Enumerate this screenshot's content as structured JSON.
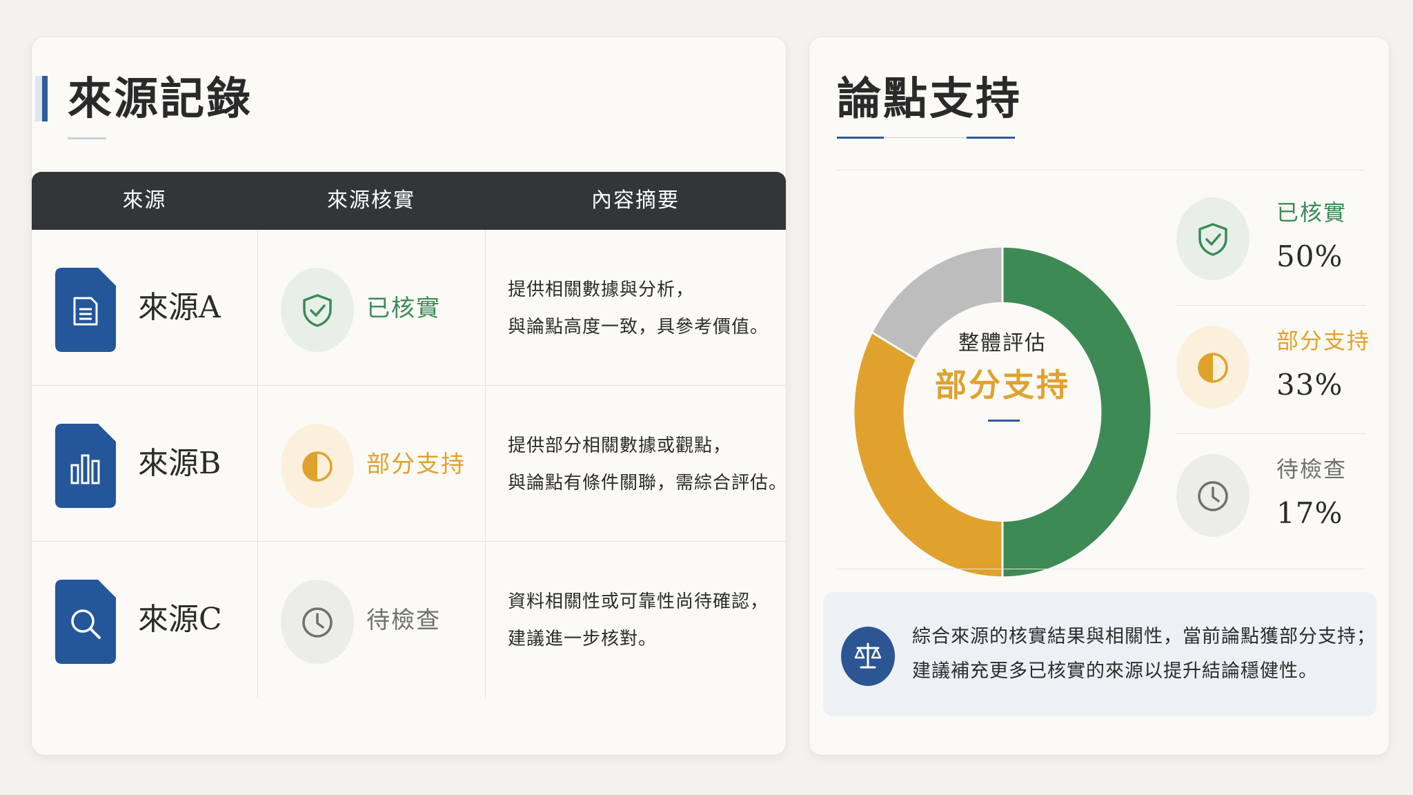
{
  "left_panel": {
    "title": "來源記錄",
    "headers": [
      "來源",
      "來源核實",
      "內容摘要"
    ],
    "rows": [
      {
        "name": "來源A",
        "icon": "document-icon",
        "status": "已核實",
        "summary": [
          "提供相關數據與分析，",
          "與論點高度一致，具參考價值。"
        ]
      },
      {
        "name": "來源B",
        "icon": "bar-chart-icon",
        "status": "部分支持",
        "summary": [
          "提供部分相關數據或觀點，",
          "與論點有條件關聯，需綜合評估。"
        ]
      },
      {
        "name": "來源C",
        "icon": "search-icon",
        "status": "待檢查",
        "summary": [
          "資料相關性或可靠性尚待確認，",
          "建議進一步核對。"
        ]
      }
    ]
  },
  "right_panel": {
    "title": "論點支持",
    "center_label": "整體評估",
    "center_value": "部分支持",
    "legend": [
      {
        "label": "已核實",
        "pct": "50%",
        "icon": "shield-check-icon"
      },
      {
        "label": "部分支持",
        "pct": "33%",
        "icon": "half-circle-icon"
      },
      {
        "label": "待檢查",
        "pct": "17%",
        "icon": "clock-icon"
      }
    ],
    "conclusion": [
      "綜合來源的核實結果與相關性，當前論點獲部分支持；",
      "建議補充更多已核實的來源以提升結論穩健性。"
    ],
    "conclusion_icon": "balance-scale-icon"
  },
  "colors": {
    "verified": "#3d8a55",
    "partial": "#e0a22c",
    "pending": "#bdbdbd",
    "accent": "#2f5a9a",
    "header_bg": "#333537"
  },
  "chart_data": {
    "type": "pie",
    "categories": [
      "已核實",
      "部分支持",
      "待檢查"
    ],
    "values": [
      50,
      33,
      17
    ],
    "title": "",
    "legend": "right"
  }
}
